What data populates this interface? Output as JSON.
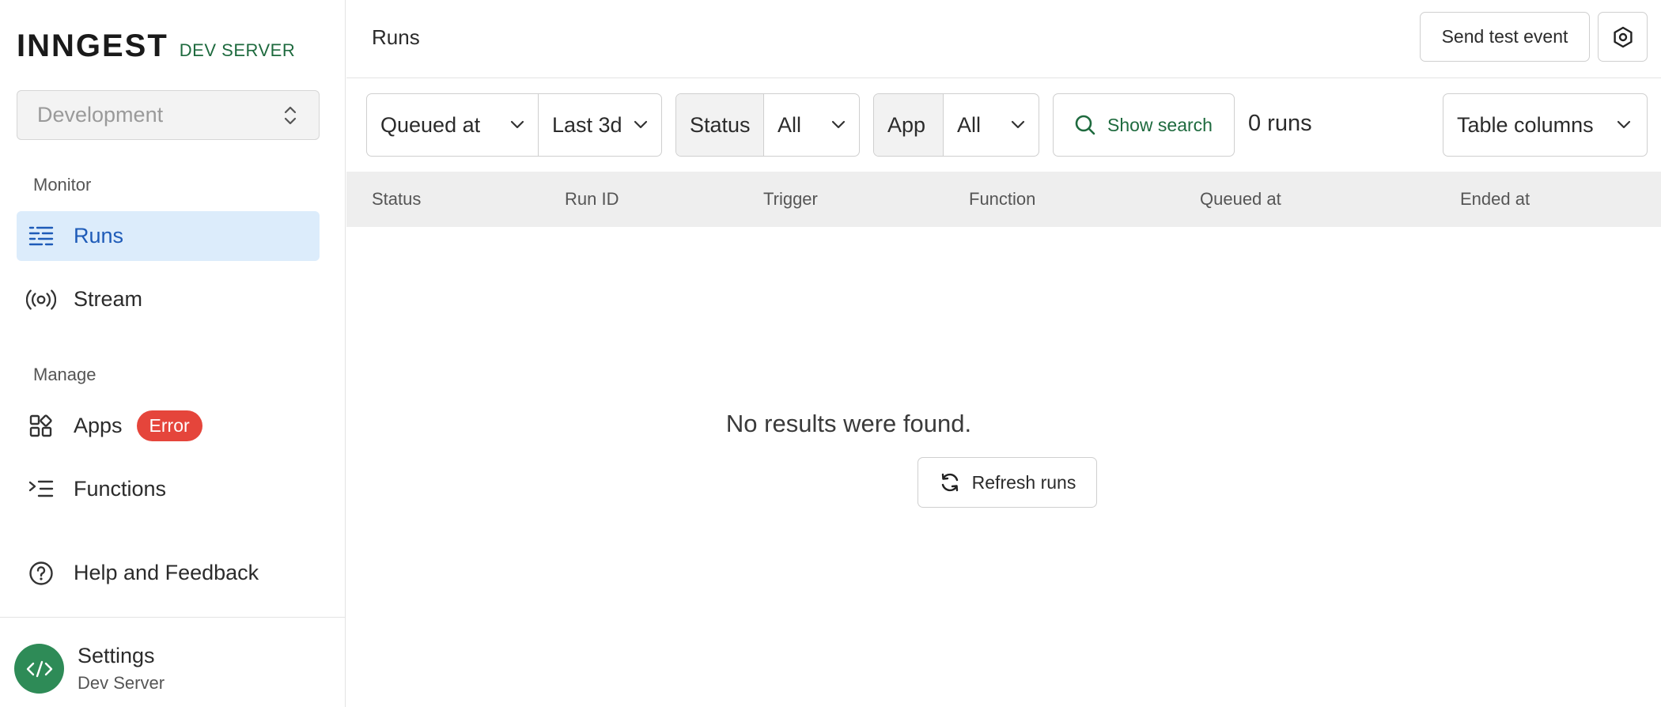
{
  "brand": {
    "logo": "INNGEST",
    "subtitle": "DEV SERVER"
  },
  "environment": {
    "selected": "Development"
  },
  "sidebar": {
    "sections": [
      {
        "label": "Monitor"
      },
      {
        "label": "Manage"
      }
    ],
    "items": [
      {
        "label": "Runs",
        "icon": "runs-list-icon",
        "active": true
      },
      {
        "label": "Stream",
        "icon": "broadcast-icon"
      },
      {
        "label": "Apps",
        "icon": "apps-grid-icon",
        "badge": "Error"
      },
      {
        "label": "Functions",
        "icon": "functions-icon"
      },
      {
        "label": "Help and Feedback",
        "icon": "help-circle-icon"
      }
    ],
    "settings": {
      "title": "Settings",
      "subtitle": "Dev Server",
      "icon": "code-icon"
    }
  },
  "header": {
    "title": "Runs",
    "send_test_label": "Send test event",
    "settings_icon": "gear-icon"
  },
  "filters": {
    "time_field": "Queued at",
    "time_range": "Last 3d",
    "status_label": "Status",
    "status_value": "All",
    "app_label": "App",
    "app_value": "All",
    "show_search_label": "Show search",
    "run_count": "0 runs",
    "table_columns_label": "Table columns"
  },
  "table": {
    "columns": [
      "Status",
      "Run ID",
      "Trigger",
      "Function",
      "Queued at",
      "Ended at"
    ]
  },
  "empty_state": {
    "message": "No results were found.",
    "refresh_label": "Refresh runs"
  },
  "colors": {
    "accent_green": "#1e6a3e",
    "active_bg": "#dcecfb",
    "active_text": "#1e5bb8",
    "error_badge": "#e5453b"
  }
}
